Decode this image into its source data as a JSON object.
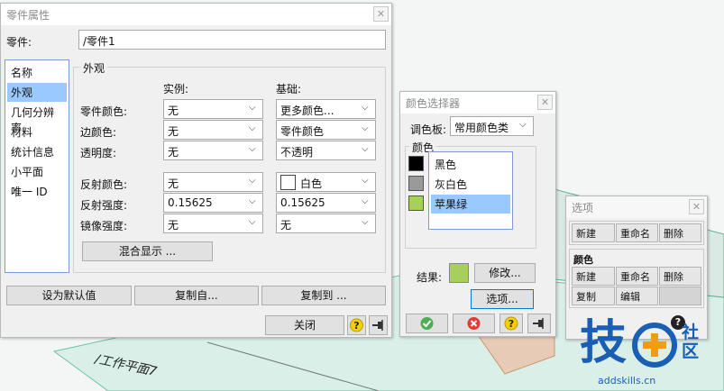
{
  "part_props": {
    "title": "零件属性",
    "part_label": "零件:",
    "part_value": "/零件1",
    "nav": [
      "名称",
      "外观",
      "几何分辨率",
      "材料",
      "统计信息",
      "小平面",
      "唯一 ID"
    ],
    "appearance_title": "外观",
    "col_instance": "实例:",
    "col_base": "基础:",
    "rows": [
      {
        "label": "零件颜色:",
        "instance": "无",
        "base": "更多颜色..."
      },
      {
        "label": "边颜色:",
        "instance": "无",
        "base": "零件颜色"
      },
      {
        "label": "透明度:",
        "instance": "无",
        "base": "不透明"
      },
      {
        "label": "反射颜色:",
        "instance": "无",
        "base": "白色"
      },
      {
        "label": "反射强度:",
        "instance": "0.15625",
        "base": "0.15625"
      },
      {
        "label": "镜像强度:",
        "instance": "无",
        "base": "无"
      }
    ],
    "blend_button": "混合显示 ...",
    "set_default": "设为默认值",
    "copy_from": "复制自...",
    "copy_to": "复制到 ...",
    "close": "关闭"
  },
  "color_picker": {
    "title": "颜色选择器",
    "palette_label": "调色板:",
    "palette_value": "常用颜色类",
    "group_title": "颜色",
    "colors": [
      {
        "name": "黑色",
        "hex": "#000000"
      },
      {
        "name": "灰白色",
        "hex": "#9a9a9a"
      },
      {
        "name": "苹果绿",
        "hex": "#a6d05b"
      }
    ],
    "result_label": "结果:",
    "result_hex": "#a6d05b",
    "modify": "修改...",
    "options": "选项..."
  },
  "options_panel": {
    "title": "选项",
    "row1": [
      "新建",
      "重命名",
      "删除"
    ],
    "section": "颜色",
    "row2": [
      "新建",
      "重命名",
      "删除"
    ],
    "row3": [
      "复制",
      "编辑"
    ]
  },
  "viewport": {
    "plane_label": "/工作平面7",
    "logo_char": "技",
    "logo_side": "社区",
    "logo_url": "addskills.cn"
  },
  "colors": {
    "accent_blue": "#99c9ff",
    "apple_green": "#a6d05b",
    "logo_blue": "#1a5fb4",
    "logo_orange": "#f39c12"
  }
}
